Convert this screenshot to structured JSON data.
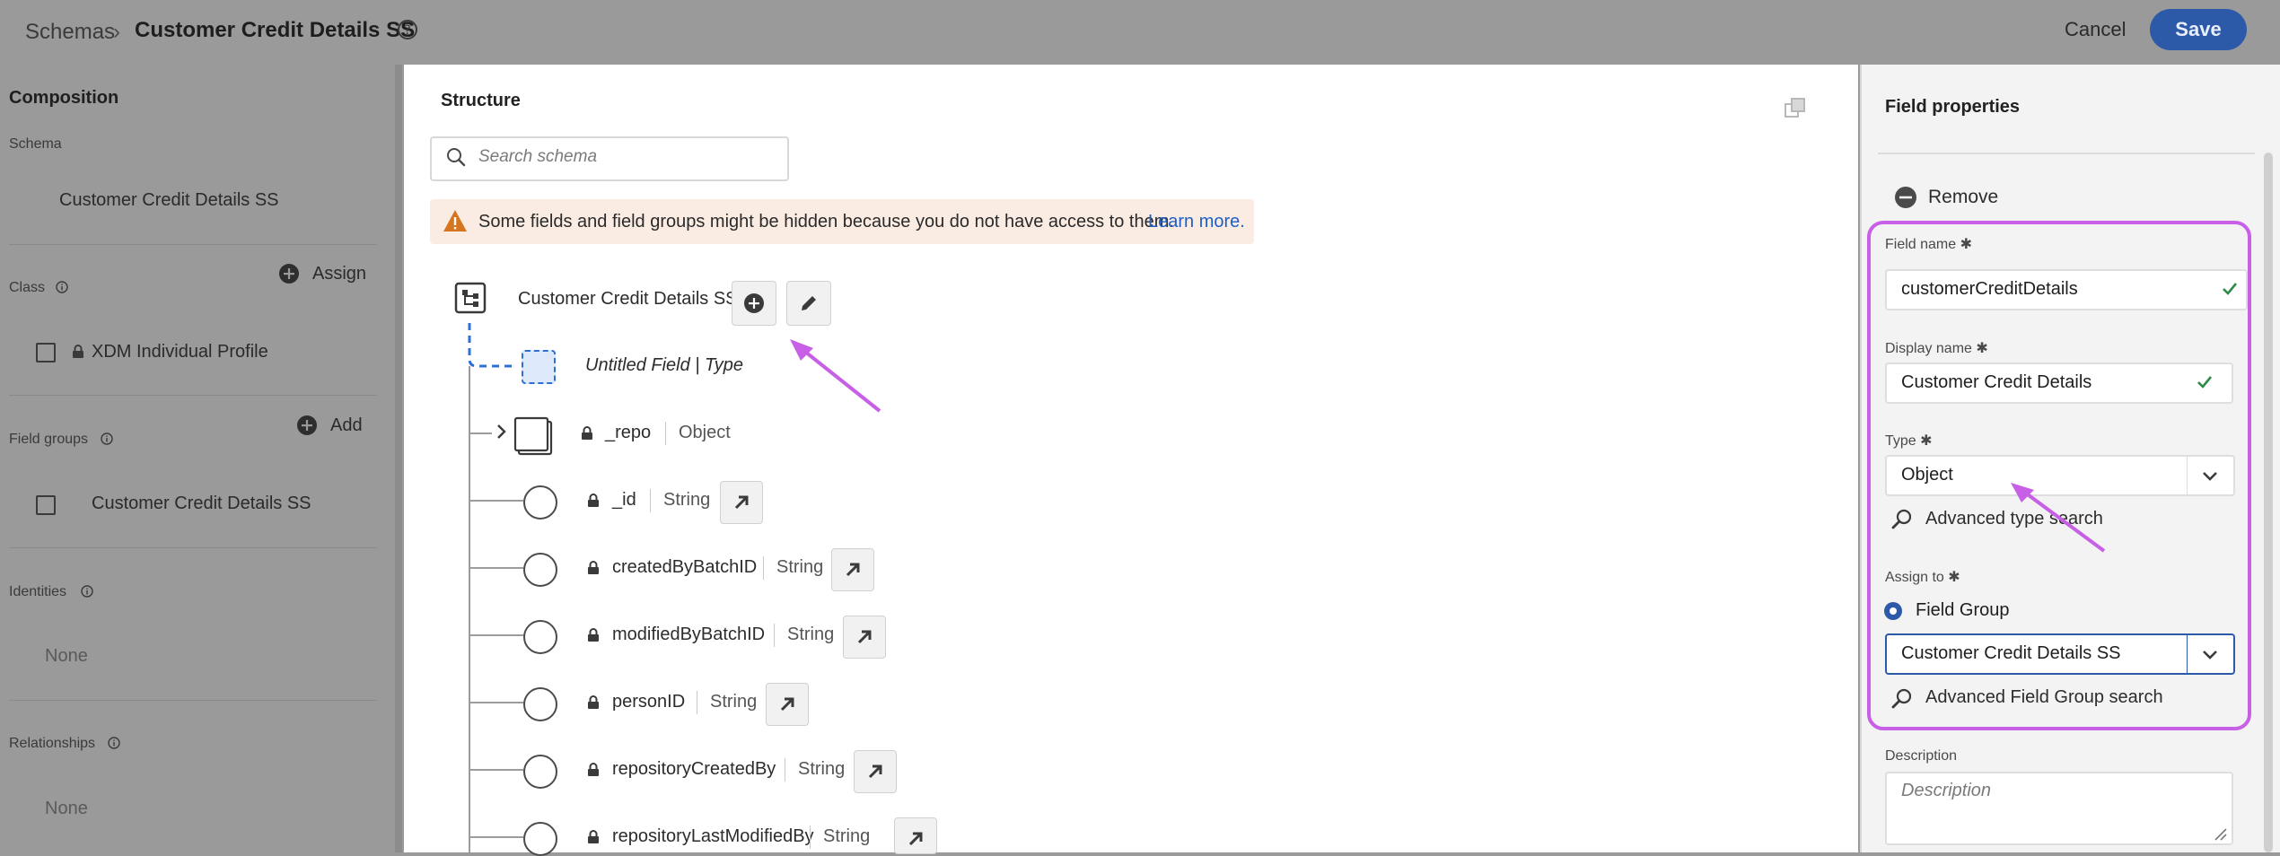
{
  "header": {
    "breadcrumb_root": "Schemas",
    "separator": "›",
    "title": "Customer Credit Details SS",
    "cancel_label": "Cancel",
    "save_label": "Save"
  },
  "composition": {
    "title": "Composition",
    "schema_label": "Schema",
    "schema_value": "Customer Credit Details SS",
    "class_label": "Class",
    "assign_label": "Assign",
    "class_value": "XDM Individual Profile",
    "field_groups_label": "Field groups",
    "add_label": "Add",
    "field_group_value": "Customer Credit Details SS",
    "identities_label": "Identities",
    "identities_value": "None",
    "relationships_label": "Relationships",
    "relationships_value": "None"
  },
  "structure": {
    "title": "Structure",
    "search_placeholder": "Search schema",
    "warning_text": "Some fields and field groups might be hidden because you do not have access to them.",
    "learn_more": "Learn more.",
    "root_name": "Customer Credit Details SS",
    "untitled_field": "Untitled Field | Type",
    "repo_name": "_repo",
    "repo_type": "Object",
    "fields": [
      {
        "name": "_id",
        "type": "String"
      },
      {
        "name": "createdByBatchID",
        "type": "String"
      },
      {
        "name": "modifiedByBatchID",
        "type": "String"
      },
      {
        "name": "personID",
        "type": "String"
      },
      {
        "name": "repositoryCreatedBy",
        "type": "String"
      },
      {
        "name": "repositoryLastModifiedBy",
        "type": "String"
      }
    ]
  },
  "field_properties": {
    "title": "Field properties",
    "remove_label": "Remove",
    "field_name_label": "Field name",
    "field_name_value": "customerCreditDetails",
    "display_name_label": "Display name",
    "display_name_value": "Customer Credit Details",
    "type_label": "Type",
    "type_value": "Object",
    "advanced_type_search": "Advanced type search",
    "assign_to_label": "Assign to",
    "assign_option": "Field Group",
    "field_group_value": "Customer Credit Details SS",
    "advanced_field_group_search": "Advanced Field Group search",
    "description_label": "Description",
    "description_placeholder": "Description",
    "required_marker": "✱"
  },
  "colors": {
    "accent": "#2d5aa8",
    "highlight": "#c760e6",
    "link": "#1d5fc8",
    "warning": "#d5751f",
    "check": "#2d8a47"
  },
  "icons": [
    "help-icon",
    "search-icon",
    "warning-icon",
    "copy-icon",
    "schema-root-icon",
    "add-icon",
    "edit-icon",
    "lock-icon",
    "chevron-right-icon",
    "object-icon",
    "arrow-link-icon",
    "remove-icon",
    "checkmark-icon",
    "chevron-down-icon",
    "info-icon",
    "radio-icon",
    "resize-icon"
  ]
}
